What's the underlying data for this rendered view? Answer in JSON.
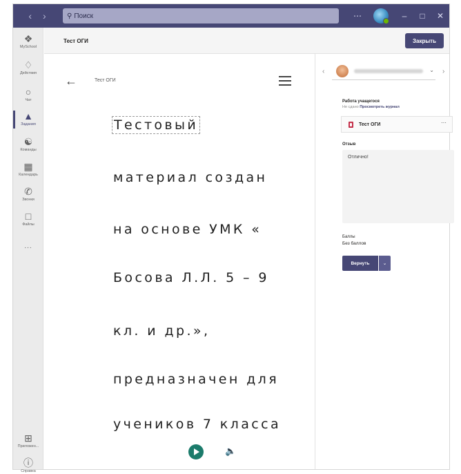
{
  "titlebar": {
    "search_placeholder": "Поиск",
    "icons": [
      "back-arrow-icon",
      "forward-arrow-icon",
      "more-icon",
      "minimize-icon",
      "maximize-icon",
      "close-icon"
    ]
  },
  "rail": {
    "items": [
      {
        "label": "MySchool",
        "icon": "school-icon"
      },
      {
        "label": "Действия",
        "icon": "bell-icon"
      },
      {
        "label": "Чат",
        "icon": "chat-icon"
      },
      {
        "label": "Задания",
        "icon": "assignments-icon",
        "active": true
      },
      {
        "label": "Команды",
        "icon": "teams-icon"
      },
      {
        "label": "Календарь",
        "icon": "calendar-icon"
      },
      {
        "label": "Звонки",
        "icon": "phone-icon"
      },
      {
        "label": "Файлы",
        "icon": "file-icon"
      },
      {
        "label": "Приложен...",
        "icon": "apps-icon"
      },
      {
        "label": "Справка",
        "icon": "help-icon"
      }
    ],
    "more": "..."
  },
  "header": {
    "title": "Тест ОГИ",
    "close_label": "Закрыть"
  },
  "viewer": {
    "doc_name": "Тест ОГИ",
    "lines": [
      "Тестовый",
      "материал создан",
      "на основе УМК «",
      "Босова Л.Л. 5 – 9",
      "кл. и др.»,",
      "предназначен для",
      "учеников 7 класса"
    ]
  },
  "panel": {
    "work_label": "Работа учащегося",
    "work_status": "Не сдано",
    "view_journal": "Просмотреть журнал",
    "file_name": "Тест ОГИ",
    "feedback_label": "Отзыв",
    "feedback_text": "Отлично!",
    "points_label": "Баллы",
    "points_value": "Без баллов",
    "return_label": "Вернуть"
  },
  "colors": {
    "brand": "#464775",
    "play": "#1b7b6b",
    "file_icon": "#c4314b"
  }
}
